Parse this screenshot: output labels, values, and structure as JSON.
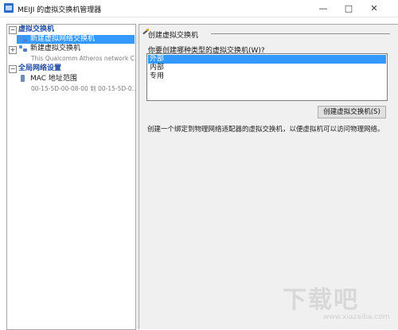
{
  "window": {
    "title": "MEIJI 的虚拟交换机管理器",
    "controls": [
      "—",
      "□",
      "✕"
    ]
  },
  "sidebar": {
    "virtual_switches_header": "虚拟交换机",
    "items": [
      {
        "label": "新建虚拟网络交换机",
        "selected": true
      },
      {
        "label": "新建虚拟交换机",
        "sub": "This Qualcomm Atheros network C..."
      }
    ],
    "global_header": "全局网络设置",
    "mac": {
      "label": "MAC 地址范围",
      "sub": "00-15-5D-00-08-00 到 00-15-5D-0..."
    }
  },
  "main": {
    "section_title": "创建虚拟交换机",
    "question": "你要创建哪种类型的虚拟交换机(W)?",
    "options": [
      "外部",
      "内部",
      "专用"
    ],
    "selected_option": "外部",
    "create_button": "创建虚拟交换机(S)",
    "description": "创建一个绑定到物理网络适配器的虚拟交换机，以便虚拟机可以访问物理网络。"
  },
  "watermark": {
    "text": "下载吧",
    "url": "www.xiazaiba.com"
  },
  "colors": {
    "selection": "#3399ff",
    "header_text": "#1f4ea3",
    "pane_bg": "#f0f0f0"
  },
  "icons": {
    "app": "switch-manager-icon",
    "tree_switch": "network-switch-icon",
    "mac": "mac-range-icon",
    "section": "wand-icon"
  }
}
